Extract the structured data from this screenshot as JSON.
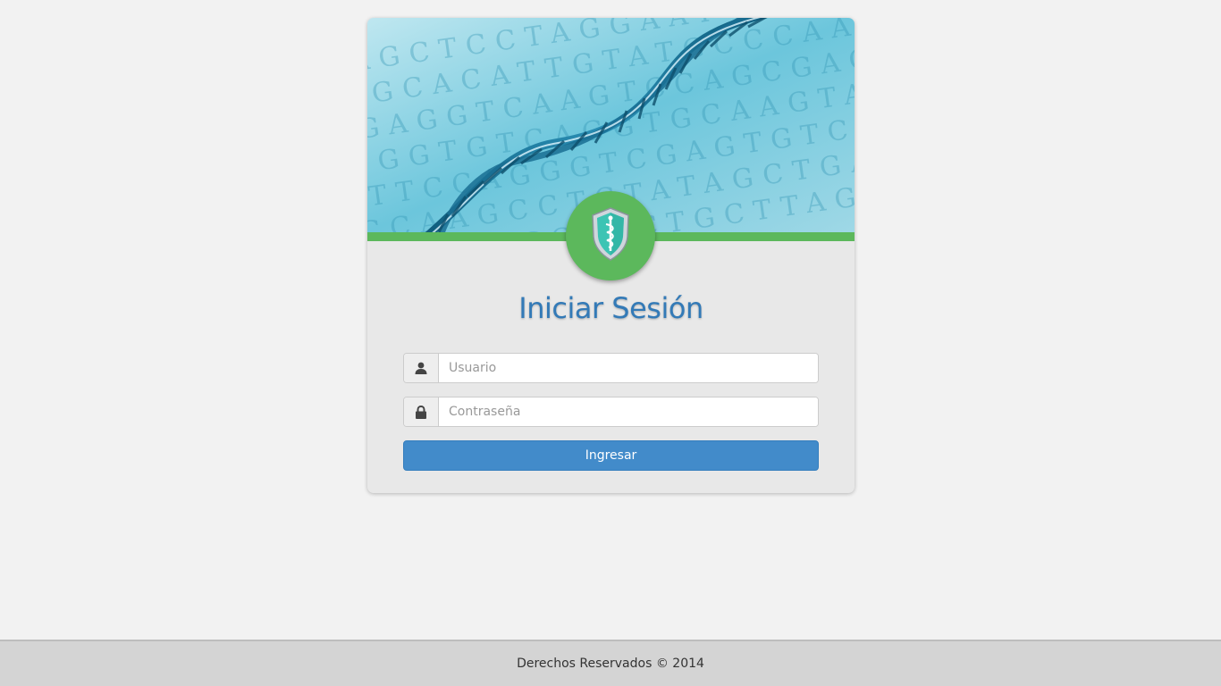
{
  "login": {
    "title": "Iniciar Sesión",
    "username": {
      "placeholder": "Usuario",
      "value": ""
    },
    "password": {
      "placeholder": "Contraseña",
      "value": ""
    },
    "submit_label": "Ingresar"
  },
  "banner": {
    "image": "dna-helix-background",
    "dna_letter_rows": [
      "CAGCTCCTAGGAATCCGTAG",
      "GGCACATTGTATGCCCAAGT",
      "AGAGGTCAAGTCCAGCGAGT",
      "TGGTGTCAGGTGCAAGTAAT",
      "CTTCCAGGGTCGAGTGTCAG",
      "CCAAGCCTCTATAGCTGACT",
      "TCCAAGCCAACTGCTTAGGC"
    ]
  },
  "logo": {
    "icon": "medical-shield-caduceus-icon"
  },
  "footer": {
    "text": "Derechos Reservados © 2014"
  },
  "colors": {
    "accent_green": "#5cb85c",
    "title_blue": "#337ab7",
    "button_blue": "#428bca",
    "page_bg": "#f2f2f2",
    "card_bg": "#e8e8e8",
    "footer_bg": "#d4d4d4"
  }
}
